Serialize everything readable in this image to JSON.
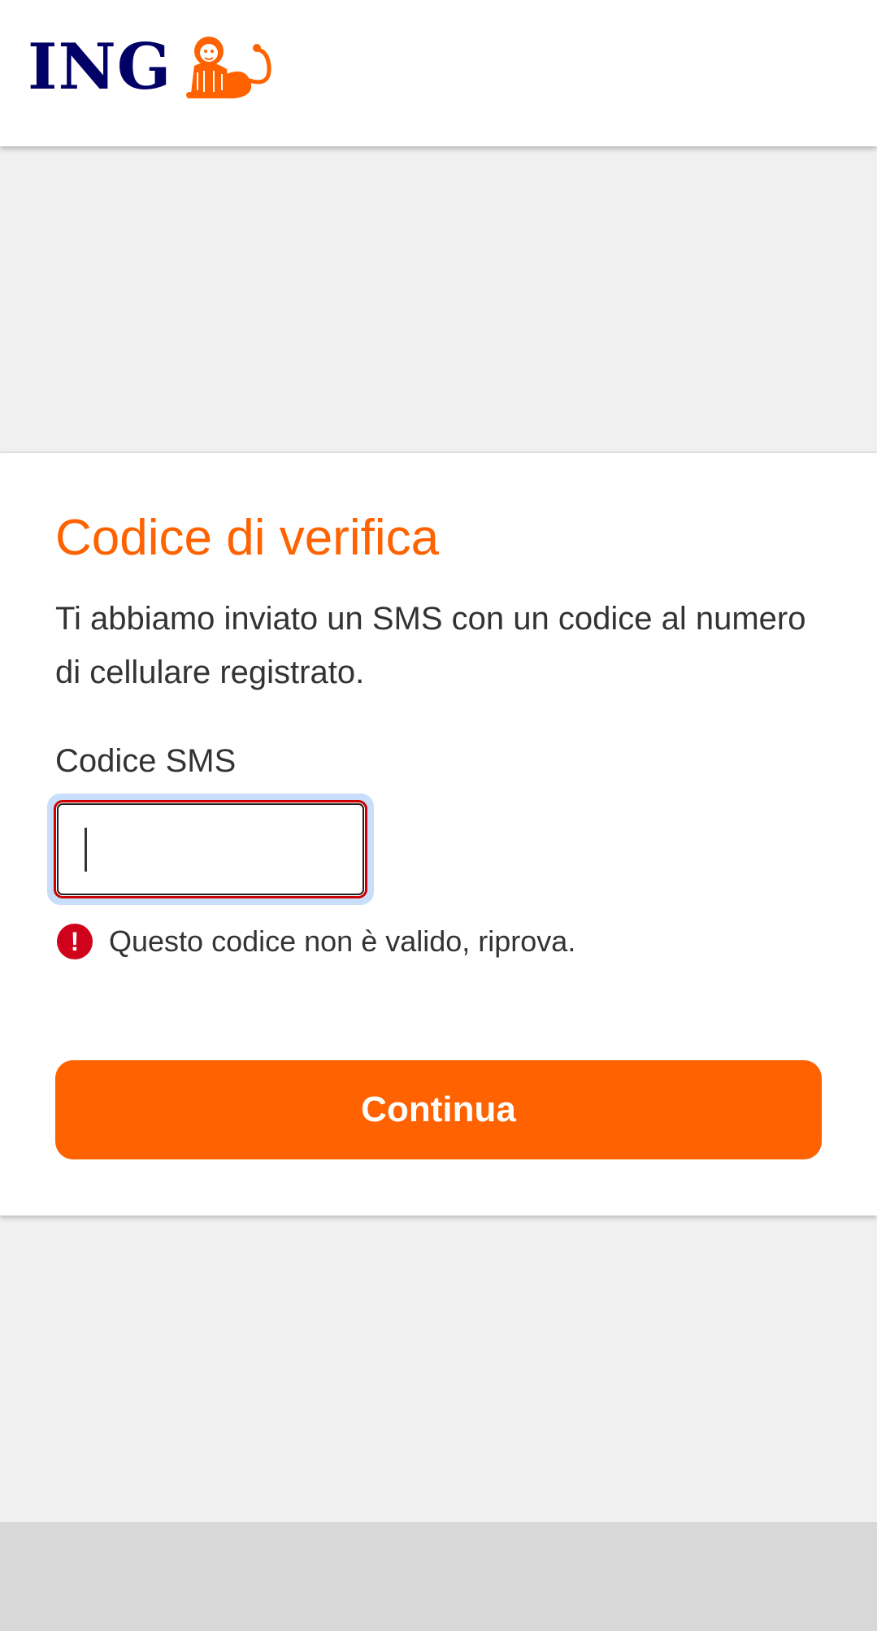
{
  "header": {
    "brand": "ING"
  },
  "verification": {
    "title": "Codice di verifica",
    "description": "Ti abbiamo inviato un SMS con un codice al numero di cellulare registrato.",
    "field_label": "Codice SMS",
    "input_value": "",
    "error_icon_glyph": "!",
    "error_message": "Questo codice non è valido, riprova.",
    "continue_label": "Continua"
  },
  "colors": {
    "brand_orange": "#ff6200",
    "brand_navy": "#000066",
    "error_red": "#d0021b",
    "focus_ring": "#c9defb"
  },
  "icons": {
    "logo": "ing-lion-icon",
    "error": "exclamation-circle-icon"
  }
}
